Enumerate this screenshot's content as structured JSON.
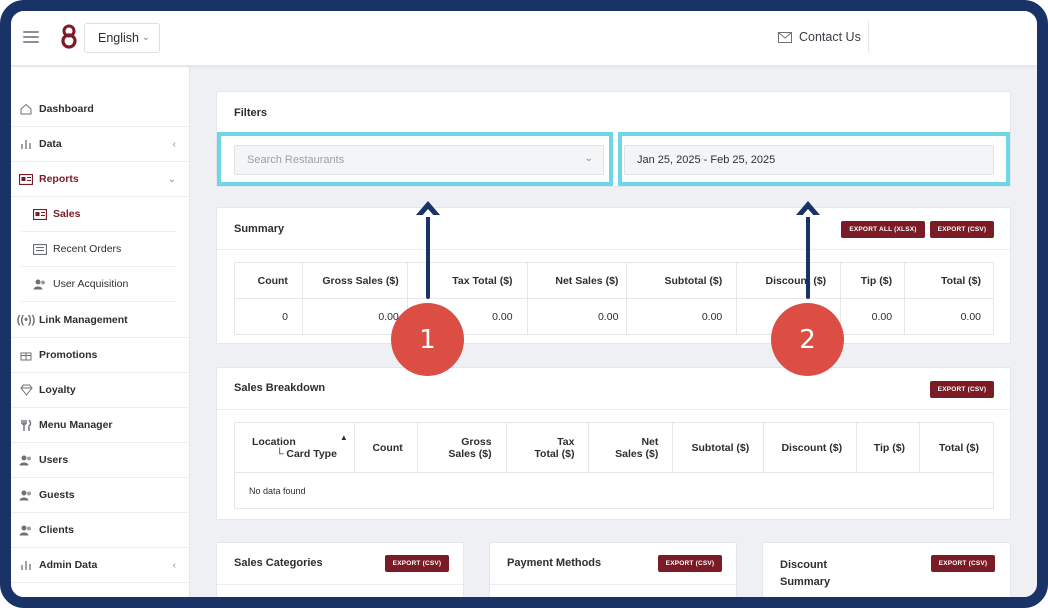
{
  "topbar": {
    "language": "English",
    "contact_label": "Contact Us",
    "brand_color": "#7a1b26"
  },
  "sidebar": {
    "items": [
      {
        "label": "Dashboard",
        "icon": "home-icon"
      },
      {
        "label": "Data",
        "icon": "bar-chart-icon"
      },
      {
        "label": "Reports",
        "icon": "report-icon"
      },
      {
        "label": "Sales",
        "icon": "report-icon"
      },
      {
        "label": "Recent Orders",
        "icon": "list-icon"
      },
      {
        "label": "User Acquisition",
        "icon": "users-icon"
      },
      {
        "label": "Link Management",
        "icon": "broadcast-icon"
      },
      {
        "label": "Promotions",
        "icon": "gift-icon"
      },
      {
        "label": "Loyalty",
        "icon": "diamond-icon"
      },
      {
        "label": "Menu Manager",
        "icon": "utensils-icon"
      },
      {
        "label": "Users",
        "icon": "users-icon"
      },
      {
        "label": "Guests",
        "icon": "users-icon"
      },
      {
        "label": "Clients",
        "icon": "users-icon"
      },
      {
        "label": "Admin Data",
        "icon": "bar-chart-icon"
      }
    ]
  },
  "filters": {
    "title": "Filters",
    "restaurant_placeholder": "Search Restaurants",
    "date_range": "Jan 25, 2025 - Feb 25, 2025"
  },
  "summary": {
    "title": "Summary",
    "export_all": "EXPORT ALL (XLSX)",
    "export_csv": "EXPORT (CSV)",
    "columns": [
      "Count",
      "Gross Sales ($)",
      "Tax Total ($)",
      "Net Sales ($)",
      "Subtotal ($)",
      "Discount ($)",
      "Tip ($)",
      "Total ($)"
    ],
    "values": [
      "0",
      "0.00",
      "0.00",
      "0.00",
      "0.00",
      "",
      "0.00",
      "0.00"
    ]
  },
  "sales_breakdown": {
    "title": "Sales Breakdown",
    "export_csv": "EXPORT (CSV)",
    "col_location": "Location",
    "col_card_type": "└ Card Type",
    "col_count": "Count",
    "col_gross_1": "Gross",
    "col_gross_2": "Sales ($)",
    "col_tax_1": "Tax",
    "col_tax_2": "Total ($)",
    "col_net_1": "Net",
    "col_net_2": "Sales ($)",
    "col_subtotal": "Subtotal ($)",
    "col_discount": "Discount ($)",
    "col_tip": "Tip ($)",
    "col_total": "Total ($)",
    "empty": "No data found"
  },
  "bottom_cards": {
    "sales_categories": "Sales Categories",
    "payment_methods": "Payment Methods",
    "discount_summary_1": "Discount",
    "discount_summary_2": "Summary",
    "export_csv": "EXPORT (CSV)"
  },
  "annotations": {
    "marker_1": "1",
    "marker_2": "2",
    "highlight_color": "#6ed6e4",
    "marker_color": "#dc4d44",
    "arrow_color": "#1a3366"
  }
}
